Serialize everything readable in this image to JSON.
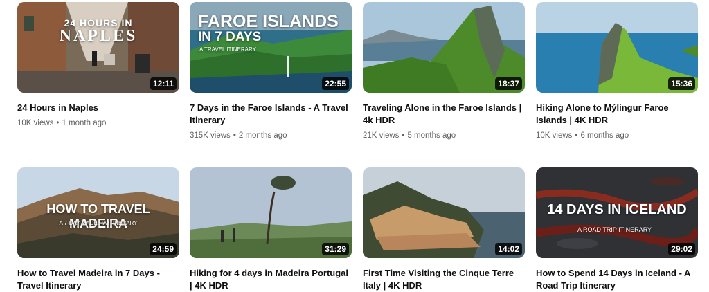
{
  "videos": [
    {
      "title": "24 Hours in Naples",
      "views": "10K views",
      "age": "1 month ago",
      "duration": "12:11",
      "overlay": {
        "line1": "24 HOURS IN",
        "line2": "NAPLES"
      }
    },
    {
      "title": "7 Days in the Faroe Islands - A Travel Itinerary",
      "views": "315K views",
      "age": "2 months ago",
      "duration": "22:55",
      "overlay": {
        "line1": "FAROE ISLANDS",
        "line2": "IN 7 DAYS",
        "line3": "A TRAVEL ITINERARY"
      }
    },
    {
      "title": "Traveling Alone in the Faroe Islands | 4k HDR",
      "views": "21K views",
      "age": "5 months ago",
      "duration": "18:37"
    },
    {
      "title": "Hiking Alone to Mýlingur Faroe Islands | 4K HDR",
      "views": "10K views",
      "age": "6 months ago",
      "duration": "15:36"
    },
    {
      "title": "How to Travel Madeira in 7 Days - Travel Itinerary",
      "views": "",
      "age": "",
      "duration": "24:59",
      "overlay": {
        "line1": "HOW TO TRAVEL MADEIRA",
        "line2": "A 7-DAY MADEIRA ITINERARY"
      }
    },
    {
      "title": "Hiking for 4 days in Madeira Portugal | 4K HDR",
      "views": "",
      "age": "",
      "duration": "31:29"
    },
    {
      "title": "First Time Visiting the Cinque Terre Italy | 4K HDR",
      "views": "",
      "age": "",
      "duration": "14:02"
    },
    {
      "title": "How to Spend 14 Days in Iceland - A Road Trip Itinerary",
      "views": "",
      "age": "",
      "duration": "29:02",
      "overlay": {
        "line1": "14 DAYS IN ICELAND",
        "line2": "A ROAD TRIP ITINERARY"
      }
    }
  ],
  "meta_separator": "•"
}
